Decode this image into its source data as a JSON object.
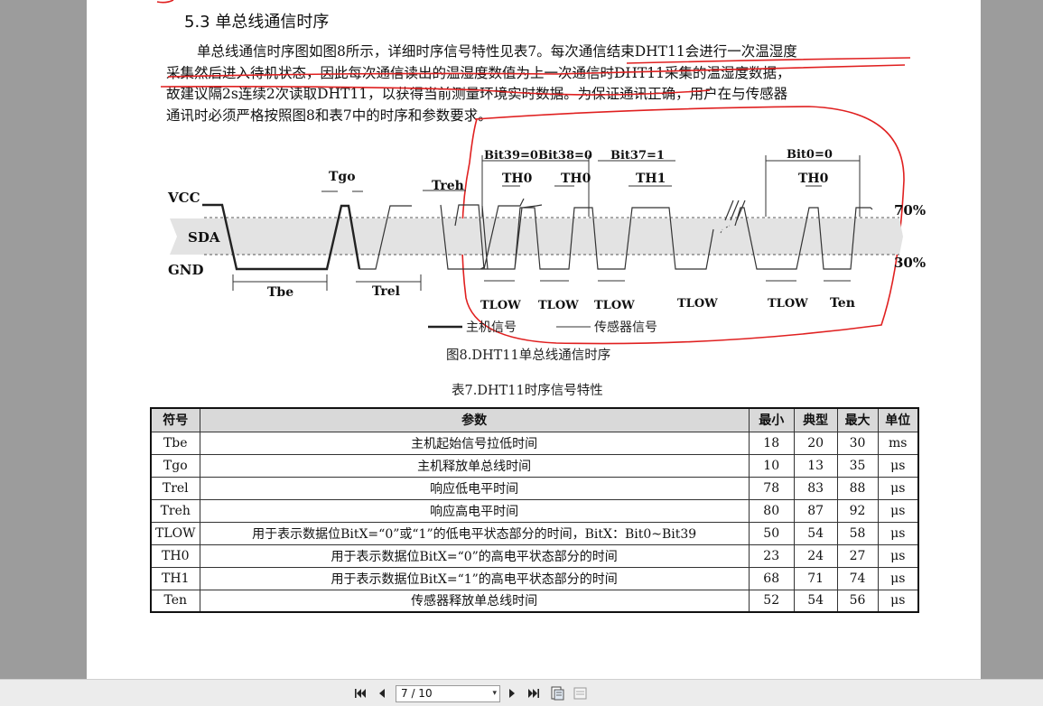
{
  "document": {
    "heading": "5.3  单总线通信时序",
    "paragraph_lines": [
      "单总线通信时序图如图8所示，详细时序信号特性见表7。每次通信结束DHT11会进行一次温湿度",
      "采集然后进入待机状态，因此每次通信读出的温湿度数值为上一次通信时DHT11采集的温湿度数据，",
      "故建议隔2s连续2次读取DHT11，以获得当前测量环境实时数据。为保证通讯正确，用户在与传感器",
      "通讯时必须严格按照图8和表7中的时序和参数要求。"
    ],
    "figure_caption": "图8.DHT11单总线通信时序",
    "table_caption": "表7.DHT11时序信号特性"
  },
  "diagram": {
    "labels": {
      "vcc": "VCC",
      "sda": "SDA",
      "gnd": "GND",
      "tgo": "Tgo",
      "treh": "Treh",
      "tbe": "Tbe",
      "trel": "Trel",
      "bit39": "Bit39=0",
      "bit38": "Bit38=0",
      "bit37": "Bit37=1",
      "bit0": "Bit0=0",
      "th0": "TH0",
      "th1": "TH1",
      "tlow": "TLOW",
      "ten": "Ten",
      "p70": "70%",
      "p30": "30%"
    },
    "legend": {
      "host": "主机信号",
      "sensor": "传感器信号"
    }
  },
  "table": {
    "headers": [
      "符号",
      "参数",
      "最小",
      "典型",
      "最大",
      "单位"
    ],
    "rows": [
      [
        "Tbe",
        "主机起始信号拉低时间",
        "18",
        "20",
        "30",
        "ms"
      ],
      [
        "Tgo",
        "主机释放单总线时间",
        "10",
        "13",
        "35",
        "μs"
      ],
      [
        "Trel",
        "响应低电平时间",
        "78",
        "83",
        "88",
        "μs"
      ],
      [
        "Treh",
        "响应高电平时间",
        "80",
        "87",
        "92",
        "μs"
      ],
      [
        "TLOW",
        "用于表示数据位BitX=“0”或“1”的低电平状态部分的时间，BitX：Bit0~Bit39",
        "50",
        "54",
        "58",
        "μs"
      ],
      [
        "TH0",
        "用于表示数据位BitX=“0”的高电平状态部分的时间",
        "23",
        "24",
        "27",
        "μs"
      ],
      [
        "TH1",
        "用于表示数据位BitX=“1”的高电平状态部分的时间",
        "68",
        "71",
        "74",
        "μs"
      ],
      [
        "Ten",
        "传感器释放单总线时间",
        "52",
        "54",
        "56",
        "μs"
      ]
    ]
  },
  "toolbar": {
    "page_indicator": "7 / 10"
  },
  "colors": {
    "annotation_red": "#e02020",
    "header_bg": "#d9d9d9",
    "toolbar_bg": "#ececec"
  },
  "icons": [
    "first-page-icon",
    "prev-page-icon",
    "next-page-icon",
    "last-page-icon",
    "fit-page-icon",
    "fit-width-icon"
  ]
}
